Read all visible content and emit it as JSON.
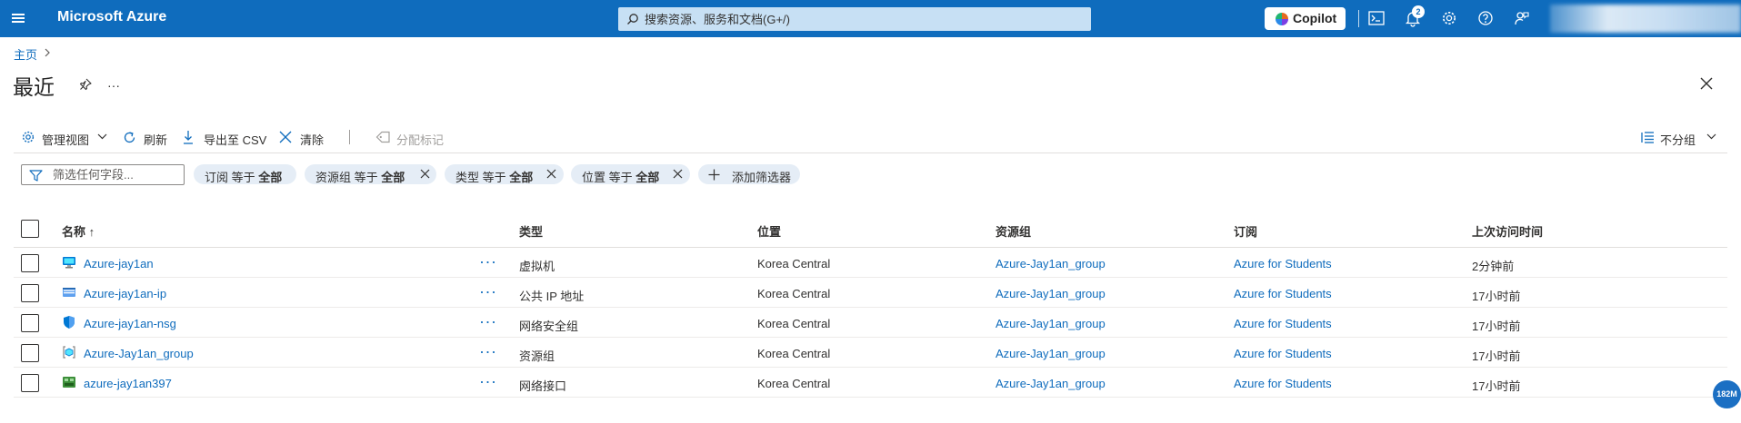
{
  "topbar": {
    "brand": "Microsoft Azure",
    "search_placeholder": "搜索资源、服务和文档(G+/)",
    "copilot_label": "Copilot",
    "notification_count": "2",
    "icons": [
      "hamburger-menu-icon",
      "cloud-shell-icon",
      "bell-icon",
      "gear-icon",
      "help-icon",
      "feedback-icon"
    ],
    "accent_color": "#0f6cbd"
  },
  "breadcrumb": {
    "home": "主页"
  },
  "page": {
    "title": "最近"
  },
  "toolbar": {
    "manage_view": "管理视图",
    "refresh": "刷新",
    "export_csv": "导出至 CSV",
    "clear": "清除",
    "assign_tags": "分配标记",
    "group_by": "不分组"
  },
  "filters": {
    "placeholder": "筛选任何字段...",
    "pills": [
      {
        "field": "订阅",
        "op": "等于",
        "value": "全部"
      },
      {
        "field": "资源组",
        "op": "等于",
        "value": "全部"
      },
      {
        "field": "类型",
        "op": "等于",
        "value": "全部"
      },
      {
        "field": "位置",
        "op": "等于",
        "value": "全部"
      }
    ],
    "add_filter": "添加筛选器"
  },
  "table": {
    "columns": {
      "name": "名称 ↑",
      "type": "类型",
      "location": "位置",
      "resource_group": "资源组",
      "subscription": "订阅",
      "last_viewed": "上次访问时间"
    },
    "rows": [
      {
        "name": "Azure-jay1an",
        "icon": "virtual-machine-icon",
        "type": "虚拟机",
        "location": "Korea Central",
        "resource_group": "Azure-Jay1an_group",
        "subscription": "Azure for Students",
        "last_viewed": "2分钟前"
      },
      {
        "name": "Azure-jay1an-ip",
        "icon": "public-ip-icon",
        "type": "公共 IP 地址",
        "location": "Korea Central",
        "resource_group": "Azure-Jay1an_group",
        "subscription": "Azure for Students",
        "last_viewed": "17小时前"
      },
      {
        "name": "Azure-jay1an-nsg",
        "icon": "network-security-group-icon",
        "type": "网络安全组",
        "location": "Korea Central",
        "resource_group": "Azure-Jay1an_group",
        "subscription": "Azure for Students",
        "last_viewed": "17小时前"
      },
      {
        "name": "Azure-Jay1an_group",
        "icon": "resource-group-icon",
        "type": "资源组",
        "location": "Korea Central",
        "resource_group": "Azure-Jay1an_group",
        "subscription": "Azure for Students",
        "last_viewed": "17小时前"
      },
      {
        "name": "azure-jay1an397",
        "icon": "network-interface-icon",
        "type": "网络接口",
        "location": "Korea Central",
        "resource_group": "Azure-Jay1an_group",
        "subscription": "Azure for Students",
        "last_viewed": "17小时前"
      }
    ]
  },
  "corner_badge": "182M"
}
